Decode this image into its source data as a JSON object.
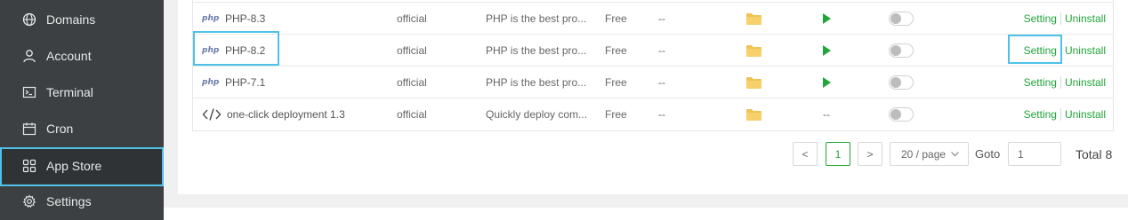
{
  "sidebar": {
    "items": [
      {
        "label": "Domains",
        "icon": "globe-icon"
      },
      {
        "label": "Account",
        "icon": "user-icon"
      },
      {
        "label": "Terminal",
        "icon": "terminal-icon"
      },
      {
        "label": "Cron",
        "icon": "calendar-icon"
      },
      {
        "label": "App Store",
        "icon": "grid-icon",
        "active": true
      },
      {
        "label": "Settings",
        "icon": "gear-icon"
      }
    ]
  },
  "table": {
    "rows": [
      {
        "name": "PHP-8.3",
        "logo": "php",
        "type": "official",
        "desc": "PHP is the best pro...",
        "price": "Free",
        "expire": "--",
        "has_start": true,
        "start": "",
        "op1": "Setting",
        "op2": "Uninstall"
      },
      {
        "name": "PHP-8.2",
        "logo": "php",
        "type": "official",
        "desc": "PHP is the best pro...",
        "price": "Free",
        "expire": "--",
        "has_start": true,
        "start": "",
        "op1": "Setting",
        "op2": "Uninstall"
      },
      {
        "name": "PHP-7.1",
        "logo": "php",
        "type": "official",
        "desc": "PHP is the best pro...",
        "price": "Free",
        "expire": "--",
        "has_start": true,
        "start": "",
        "op1": "Setting",
        "op2": "Uninstall"
      },
      {
        "name": "one-click deployment 1.3",
        "logo": "code",
        "type": "official",
        "desc": "Quickly deploy com...",
        "price": "Free",
        "expire": "--",
        "has_start": false,
        "start": "--",
        "op1": "Setting",
        "op2": "Uninstall"
      }
    ],
    "php_logo_text": "php"
  },
  "pagination": {
    "prev": "<",
    "current": "1",
    "next": ">",
    "page_size": "20 / page",
    "goto_label": "Goto",
    "goto_value": "1",
    "total": "Total 8"
  },
  "colors": {
    "accent": "#20a53a",
    "highlight": "#4fc1e9",
    "sidebar_bg": "#3c4043",
    "folder": "#f0c24f"
  }
}
